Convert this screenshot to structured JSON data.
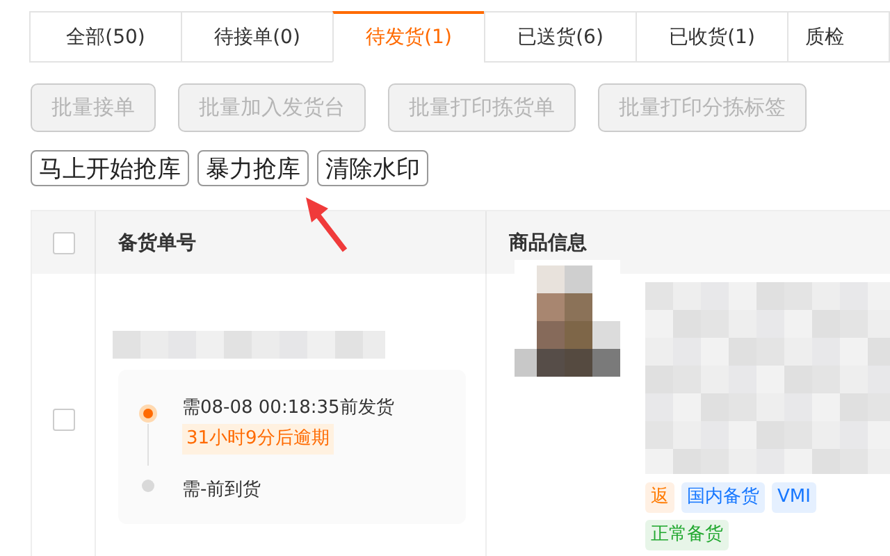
{
  "tabs": [
    {
      "label": "全部(50)",
      "selected": false
    },
    {
      "label": "待接单(0)",
      "selected": false
    },
    {
      "label": "待发货(1)",
      "selected": true
    },
    {
      "label": "已送货(6)",
      "selected": false
    },
    {
      "label": "已收货(1)",
      "selected": false
    },
    {
      "label": "质检",
      "selected": false
    }
  ],
  "batch_buttons": [
    {
      "label": "批量接单",
      "disabled": true
    },
    {
      "label": "批量加入发货台",
      "disabled": true
    },
    {
      "label": "批量打印拣货单",
      "disabled": true
    },
    {
      "label": "批量打印分拣标签",
      "disabled": true
    }
  ],
  "action_buttons": [
    "马上开始抢库",
    "暴力抢库",
    "清除水印"
  ],
  "table": {
    "header_checked": false,
    "columns": [
      "备货单号",
      "商品信息"
    ],
    "rows": [
      {
        "checked": false,
        "product": {
          "kind": "picture"
        },
        "timeline": [
          {
            "text": "需08-08 00:18:35前发货",
            "note": "31小时9分后逾期",
            "active": true
          },
          {
            "text": "需-前到货",
            "active": false
          }
        ],
        "tags": [
          {
            "label": "返",
            "color": "#ff7a00"
          },
          {
            "label": "国内备货",
            "color": "#1677ff"
          },
          {
            "label": "VMI",
            "color": "#1677ff"
          },
          {
            "label": "正常备货",
            "color": "#22a830"
          }
        ]
      }
    ]
  }
}
